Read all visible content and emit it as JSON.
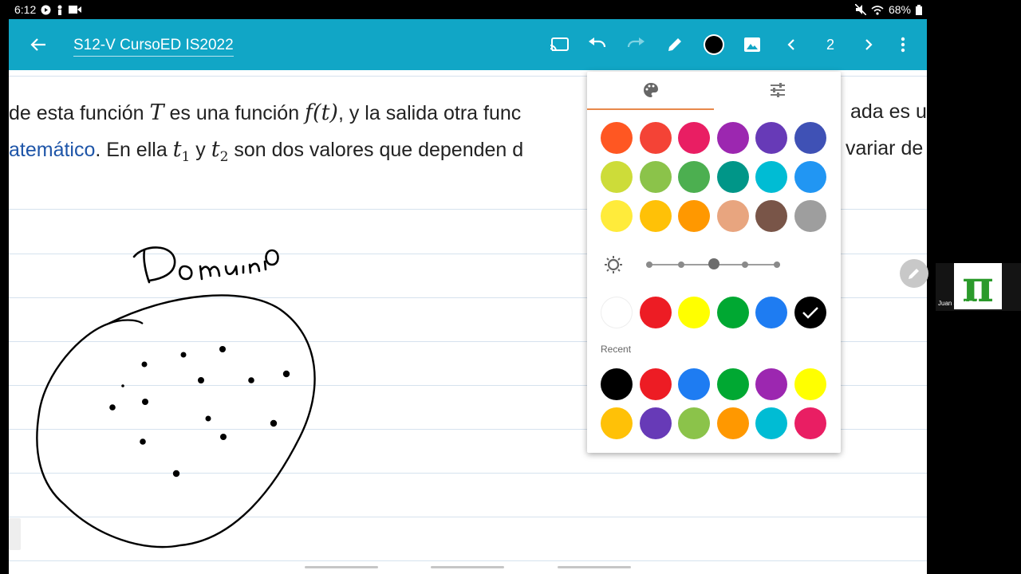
{
  "status_bar": {
    "time": "6:12",
    "battery": "68%"
  },
  "app_bar": {
    "title": "S12-V CursoED IS2022",
    "page_number": "2",
    "icons": [
      "back-arrow-icon",
      "cast-icon",
      "undo-icon",
      "redo-icon",
      "pen-icon",
      "color-dot-icon",
      "image-icon",
      "chevron-left-icon",
      "chevron-right-icon",
      "more-vert-icon"
    ]
  },
  "document": {
    "line1": {
      "a": "de esta función ",
      "m1": "T",
      "b": " es una función ",
      "m2": "f(t)",
      "c": ", y la salida otra func",
      "d": "ada es u"
    },
    "line2": {
      "link": "atemático",
      "a": ". En ella ",
      "m1": "t",
      "s1": "1",
      "b": " y ",
      "m2": "t",
      "s2": "2",
      "c": " son dos valores que dependen d",
      "d": " variar de"
    }
  },
  "color_panel": {
    "tabs": [
      "palette-icon",
      "sliders-icon"
    ],
    "palette_colors": [
      [
        "#ff5722",
        "#f44336",
        "#e91e63",
        "#9c27b0",
        "#673ab7",
        "#3f51b5"
      ],
      [
        "#cddc39",
        "#8bc34a",
        "#4caf50",
        "#009688",
        "#00bcd4",
        "#2196f3"
      ],
      [
        "#ffeb3b",
        "#ffc107",
        "#ff9800",
        "#e8a57f",
        "#795548",
        "#9e9e9e"
      ]
    ],
    "brightness": {
      "value": 0.5,
      "low_icon": "sun-icon",
      "high_icon": "moon-icon"
    },
    "quick_colors": [
      "#ffffff",
      "#ed1c24",
      "#ffff00",
      "#00a832",
      "#1e7cf2",
      "#000000"
    ],
    "selected_quick": 5,
    "recent_label": "Recent",
    "recent_colors": [
      [
        "#000000",
        "#ed1c24",
        "#1e7cf2",
        "#00a832",
        "#9c27b0",
        "#ffff00"
      ],
      [
        "#ffc107",
        "#673ab7",
        "#8bc34a",
        "#ff9800",
        "#00bcd4",
        "#e91e63"
      ]
    ]
  },
  "video_tile": {
    "name": "Juan José Fallas",
    "logo_text": "π"
  }
}
